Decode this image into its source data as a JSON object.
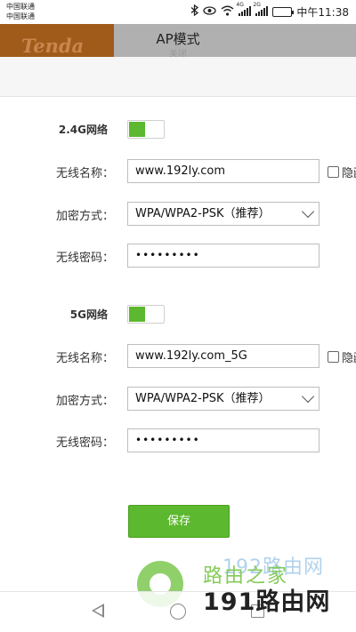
{
  "status_bar": {
    "carrier1": "中国联通",
    "carrier2": "中国联通",
    "network1": "4G",
    "network2": "2G",
    "time": "中午11:38",
    "battery_color": "#2db34a"
  },
  "header": {
    "logo": "Tenda",
    "title": "AP模式",
    "subtitle": "关闭"
  },
  "wifi_24g": {
    "section_label": "2.4G网络",
    "enabled": true,
    "ssid_label": "无线名称：",
    "ssid_value": "www.192ly.com",
    "hide_label": "隐藏",
    "encryption_label": "加密方式：",
    "encryption_value": "WPA/WPA2-PSK（推荐）",
    "password_label": "无线密码：",
    "password_value": "•••••••••"
  },
  "wifi_5g": {
    "section_label": "5G网络",
    "enabled": true,
    "ssid_label": "无线名称：",
    "ssid_value": "www.192ly.com_5G",
    "hide_label": "隐藏",
    "encryption_label": "加密方式：",
    "encryption_value": "WPA/WPA2-PSK（推荐）",
    "password_label": "无线密码：",
    "password_value": "•••••••••"
  },
  "save_label": "保存",
  "accent_color": "#5cb82e",
  "watermark": {
    "line1": "路由之家",
    "line2": "192路由网",
    "line3": "191路由网"
  }
}
